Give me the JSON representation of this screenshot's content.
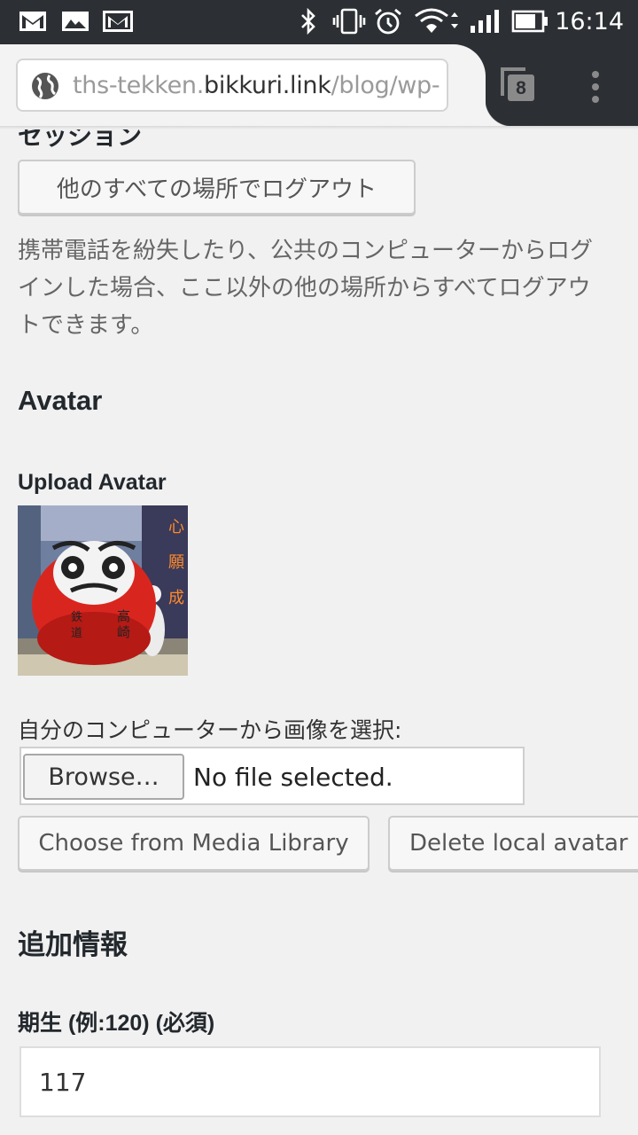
{
  "status_bar": {
    "time": "16:14",
    "icons": [
      "gmail-icon",
      "photos-icon",
      "gmail-icon",
      "bluetooth-icon",
      "vibrate-icon",
      "alarm-icon",
      "wifi-icon",
      "signal-icon",
      "battery-icon"
    ]
  },
  "browser": {
    "url_prefix": "ths-tekken.",
    "url_domain": "bikkuri.link",
    "url_suffix": "/blog/wp-",
    "tab_count": "8"
  },
  "sessions": {
    "heading": "セッション",
    "logout_button": "他のすべての場所でログアウト",
    "description": "携帯電話を紛失したり、公共のコンピューターからログインした場合、ここ以外の他の場所からすべてログアウトできます。"
  },
  "avatar": {
    "heading": "Avatar",
    "upload_label": "Upload Avatar",
    "select_label": "自分のコンピューターから画像を選択:",
    "browse_button": "Browse…",
    "file_status": "No file selected.",
    "media_library_button": "Choose from Media Library",
    "delete_button": "Delete local avatar"
  },
  "additional": {
    "heading": "追加情報",
    "field_label": "期生 (例:120) (必須)",
    "field_value": "117"
  },
  "colors": {
    "chrome_dark": "#2c2f33",
    "page_bg": "#f1f1f1",
    "button_bg": "#f7f7f7"
  }
}
